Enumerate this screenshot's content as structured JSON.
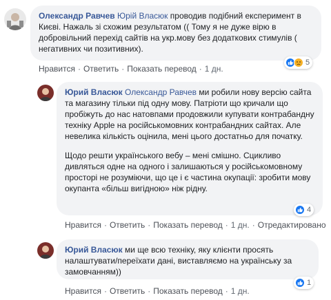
{
  "comments": [
    {
      "author": "Олександр Равчев",
      "mention": "Юрій Власюк",
      "paragraphs": [
        "проводив подібний експеримент в Києві. Нажаль зі схожим результатом (( Тому я не дуже вірю в добровільний перехід сайтів на укр.мову без додаткових стимулів ( негативних чи позитивних)."
      ],
      "reaction_count": "5",
      "actions": {
        "like": "Нравится",
        "reply": "Ответить",
        "translate": "Показать перевод",
        "time": "1 дн."
      }
    },
    {
      "author": "Юрий Власюк",
      "mention": "Олександр Равчев",
      "paragraphs": [
        "ми робили нову версію сайта та магазину тільки під одну мову. Патріоти що кричали що пробіжуть до нас натовпами продовжили купувати контрабандну техніку Apple на російськомовних контрабандних сайтах. Але невелика кількість оцінила, мені цього достатньо для початку.",
        "Щодо решти українського вебу – мені смішно. Сцикливо дивляться одне на одного і залишаються у російськомовному просторі не розуміючи, що це і є частина окупації: зробити мову окупанта «більш вигідною» ніж рідну."
      ],
      "reaction_count": "4",
      "actions": {
        "like": "Нравится",
        "reply": "Ответить",
        "translate": "Показать перевод",
        "time": "1 дн.",
        "edited": "Отредактировано"
      }
    },
    {
      "author": "Юрий Власюк",
      "mention": "",
      "paragraphs": [
        "ми ще всю техніку, яку клієнти просять налаштувати/переїхати дані, виставляємо на українську за замовчанням))"
      ],
      "reaction_count": "1",
      "actions": {
        "like": "Нравится",
        "reply": "Ответить",
        "translate": "Показать перевод",
        "time": "1 дн."
      }
    }
  ],
  "colors": {
    "like_blue": "#1877f2",
    "haha_yellow": "#f7b125",
    "link": "#385898",
    "bubble_bg": "#f2f3f5"
  },
  "icons": [
    "thumbs-up-icon",
    "sad-face-icon"
  ]
}
